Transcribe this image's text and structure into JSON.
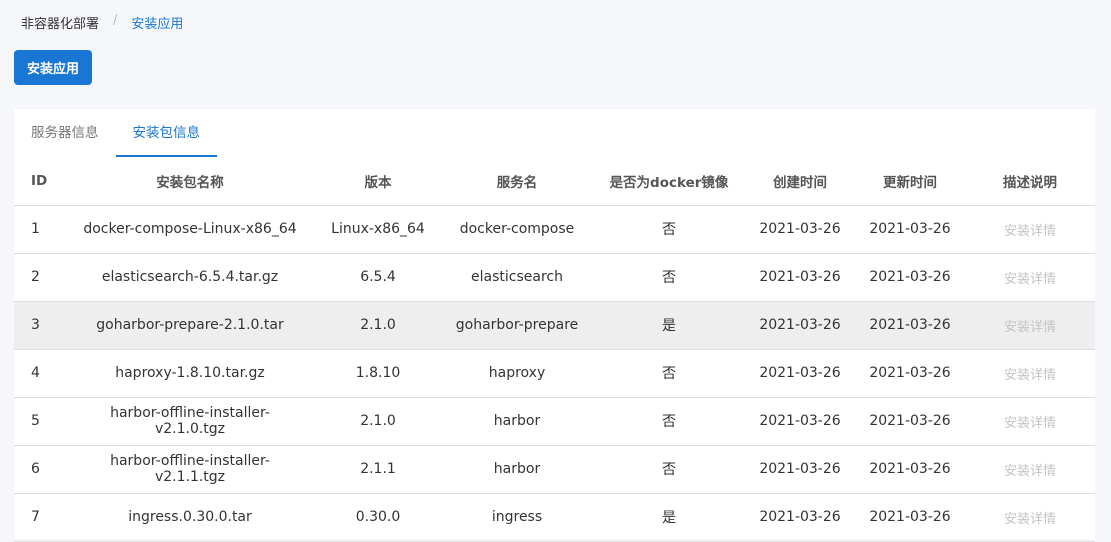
{
  "breadcrumb": [
    "非容器化部署",
    "安装应用"
  ],
  "install_button": "安装应用",
  "tabs": [
    {
      "label": "服务器信息",
      "active": false
    },
    {
      "label": "安装包信息",
      "active": true
    }
  ],
  "columns": [
    "ID",
    "安装包名称",
    "版本",
    "服务名",
    "是否为docker镜像",
    "创建时间",
    "更新时间",
    "描述说明"
  ],
  "rows": [
    [
      "1",
      "docker-compose-Linux-x86_64",
      "Linux-x86_64",
      "docker-compose",
      "否",
      "2021-03-26",
      "2021-03-26",
      "安装详情"
    ],
    [
      "2",
      "elasticsearch-6.5.4.tar.gz",
      "6.5.4",
      "elasticsearch",
      "否",
      "2021-03-26",
      "2021-03-26",
      "安装详情"
    ],
    [
      "3",
      "goharbor-prepare-2.1.0.tar",
      "2.1.0",
      "goharbor-prepare",
      "是",
      "2021-03-26",
      "2021-03-26",
      "安装详情"
    ],
    [
      "4",
      "haproxy-1.8.10.tar.gz",
      "1.8.10",
      "haproxy",
      "否",
      "2021-03-26",
      "2021-03-26",
      "安装详情"
    ],
    [
      "5",
      "harbor-offline-installer-v2.1.0.tgz",
      "2.1.0",
      "harbor",
      "否",
      "2021-03-26",
      "2021-03-26",
      "安装详情"
    ],
    [
      "6",
      "harbor-offline-installer-v2.1.1.tgz",
      "2.1.1",
      "harbor",
      "否",
      "2021-03-26",
      "2021-03-26",
      "安装详情"
    ],
    [
      "7",
      "ingress.0.30.0.tar",
      "0.30.0",
      "ingress",
      "是",
      "2021-03-26",
      "2021-03-26",
      "安装详情"
    ]
  ],
  "highlighted_row": 2,
  "colors": {
    "accent": "#1976d2",
    "hover_row": "#eeeeee"
  }
}
